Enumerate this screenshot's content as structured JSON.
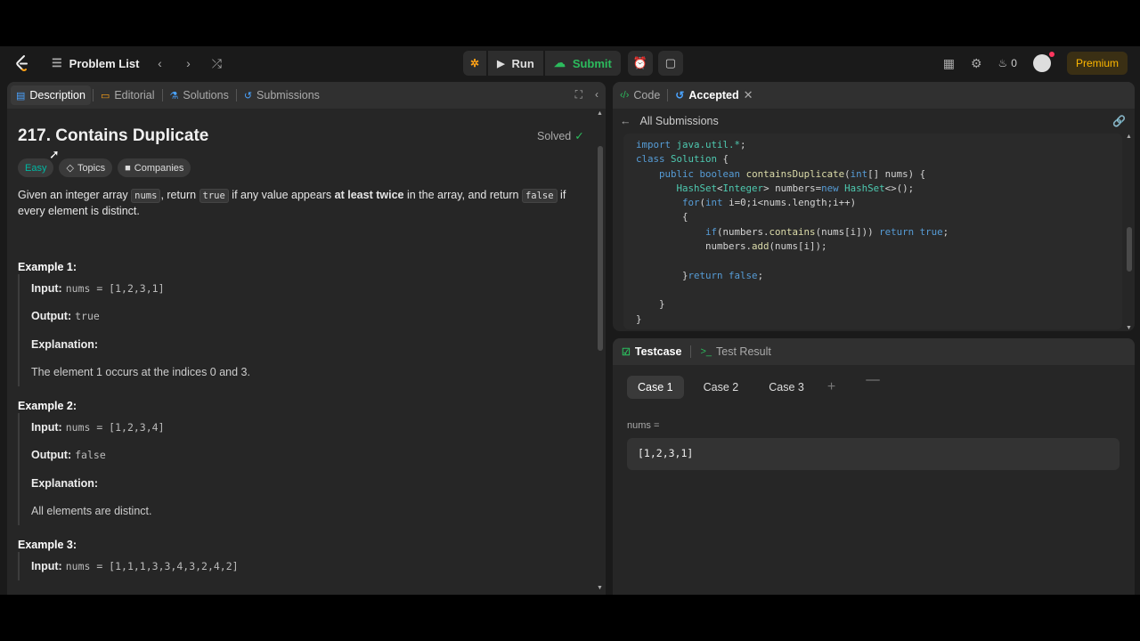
{
  "topbar": {
    "problem_list": "Problem List",
    "run": "Run",
    "submit": "Submit",
    "fire_count": "0",
    "premium": "Premium",
    "accent_green": "#2cbb5d"
  },
  "left_tabs": [
    "Description",
    "Editorial",
    "Solutions",
    "Submissions"
  ],
  "problem": {
    "title": "217. Contains Duplicate",
    "status": "Solved",
    "difficulty": "Easy",
    "tags": [
      "Topics",
      "Companies"
    ],
    "desc_1": "Given an integer array ",
    "desc_code1": "nums",
    "desc_2": ", return ",
    "desc_code2": "true",
    "desc_3": " if any value appears ",
    "desc_bold": "at least twice",
    "desc_4": " in the array, and return ",
    "desc_code3": "false",
    "desc_5": " if every element is distinct."
  },
  "examples": [
    {
      "title": "Example 1:",
      "input_label": "Input:",
      "input": "nums = [1,2,3,1]",
      "output_label": "Output:",
      "output": "true",
      "expl_label": "Explanation:",
      "explanation": "The element 1 occurs at the indices 0 and 3."
    },
    {
      "title": "Example 2:",
      "input_label": "Input:",
      "input": "nums = [1,2,3,4]",
      "output_label": "Output:",
      "output": "false",
      "expl_label": "Explanation:",
      "explanation": "All elements are distinct."
    },
    {
      "title": "Example 3:",
      "input_label": "Input:",
      "input": "nums = [1,1,1,3,3,4,3,2,4,2]"
    }
  ],
  "right_tabs": {
    "code": "Code",
    "accepted": "Accepted"
  },
  "submissions_link": "All Submissions",
  "code_lines": [
    "import java.util.*;",
    "class Solution {",
    "    public boolean containsDuplicate(int[] nums) {",
    "       HashSet<Integer> numbers=new HashSet<>();",
    "        for(int i=0;i<nums.length;i++)",
    "        {",
    "            if(numbers.contains(nums[i])) return true;",
    "            numbers.add(nums[i]);",
    "",
    "        }return false;",
    "",
    "    }",
    "}"
  ],
  "bottom_tabs": {
    "testcase": "Testcase",
    "test_result": "Test Result"
  },
  "cases": [
    "Case 1",
    "Case 2",
    "Case 3"
  ],
  "var_label": "nums =",
  "var_value": "[1,2,3,1]"
}
